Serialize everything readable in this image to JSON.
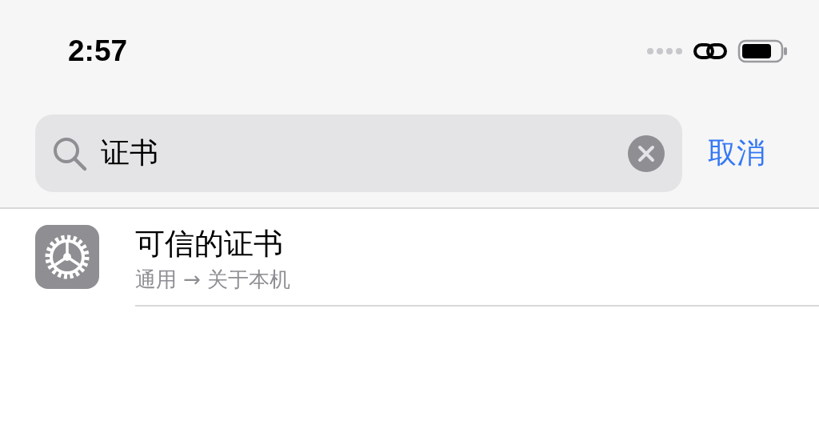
{
  "status_bar": {
    "time": "2:57"
  },
  "search": {
    "value": "证书",
    "cancel": "取消"
  },
  "results": [
    {
      "title": "可信的证书",
      "path": "通用 → 关于本机"
    }
  ]
}
